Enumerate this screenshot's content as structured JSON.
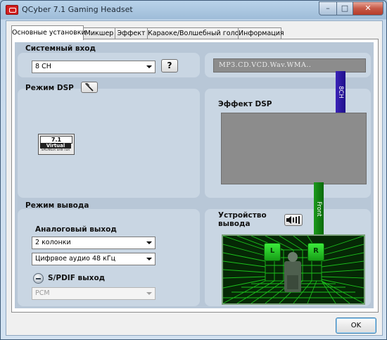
{
  "window": {
    "title": "QCyber 7.1 Gaming Headset",
    "min": "–",
    "max": "□",
    "close": "✕"
  },
  "tabs": [
    {
      "label": "Основные установки",
      "active": true
    },
    {
      "label": "Микшер",
      "active": false
    },
    {
      "label": "Эффект",
      "active": false
    },
    {
      "label": "Караоке/Волшебный голос",
      "active": false
    },
    {
      "label": "Информация",
      "active": false
    }
  ],
  "system_input": {
    "label": "Системный вход",
    "value": "8 CH",
    "help_label": "?",
    "formats_text": "MP3.CD.VCD.Wav.WMA.."
  },
  "dsp_mode": {
    "label": "Режим DSP",
    "badge_num": "7.1",
    "badge_word": "Virtual",
    "badge_sub": "SPEAKER SHIFTER"
  },
  "dsp_effect": {
    "label": "Эффект DSP"
  },
  "connectors": {
    "top": "8CH",
    "bottom": "Front"
  },
  "output_mode": {
    "label": "Режим вывода",
    "analog_label": "Аналоговый выход",
    "speakers_value": "2 колонки",
    "digital_value": "Цифрвое аудио 48 кГц",
    "spdif_label": "S/PDIF выход",
    "spdif_value": "PCM"
  },
  "output_device": {
    "label": "Устройство\nвывода",
    "left_speaker": "L",
    "right_speaker": "R"
  },
  "footer": {
    "ok_label": "OK"
  },
  "icons": {
    "app": "app-logo-icon",
    "tools": "hammer-icon",
    "speakers": "speaker-bars-icon",
    "spdif": "spdif-toggle-icon"
  },
  "colors": {
    "connector_8ch": "#2b1aa0",
    "connector_front": "#148a14",
    "scene_green": "#1fd11f"
  }
}
